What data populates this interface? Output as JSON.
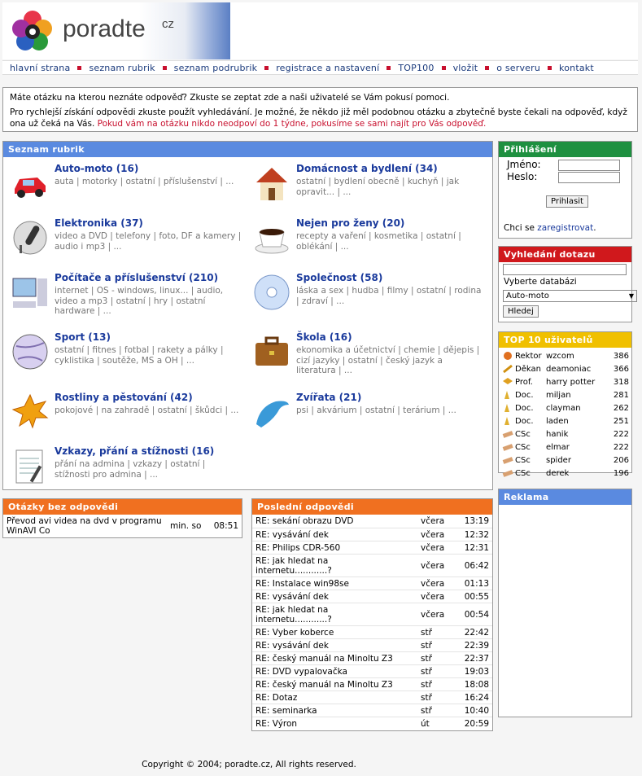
{
  "logo": {
    "text": "poradte",
    "suffix": "cz"
  },
  "nav": [
    "hlavní strana",
    "seznam rubrik",
    "seznam podrubrik",
    "registrace a nastavení",
    "TOP100",
    "vložit",
    "o serveru",
    "kontakt"
  ],
  "intro": {
    "line1": "Máte otázku na kterou neznáte odpověď? Zkuste se zeptat zde a naši uživatelé se Vám pokusí pomoci.",
    "line2": "Pro rychlejší získání odpovědi zkuste použít vyhledávání. Je možné, že někdo již měl podobnou otázku a zbytečně byste čekali na odpověď, když ona už čeká na Vás.",
    "line2_red": "Pokud vám na otázku nikdo neodpoví do 1 týdne, pokusíme se sami najít pro Vás odpověď."
  },
  "rubrics": {
    "title": "Seznam rubrik",
    "items": [
      {
        "title": "Auto-moto (16)",
        "subs": "auta | motorky | ostatní | příslušenství | ...",
        "icon": "car-icon"
      },
      {
        "title": "Domácnost a bydlení (34)",
        "subs": "ostatní | bydlení obecně | kuchyň | jak opravit... | ...",
        "icon": "house-icon"
      },
      {
        "title": "Elektronika (37)",
        "subs": "video a DVD | telefony | foto, DF a kamery | audio i mp3 | ...",
        "icon": "microphone-icon"
      },
      {
        "title": "Nejen pro ženy (20)",
        "subs": "recepty a vaření | kosmetika | ostatní | oblékání | ...",
        "icon": "coffee-cup-icon"
      },
      {
        "title": "Počítače a příslušenství (210)",
        "subs": "internet | OS - windows, linux... | audio, video a mp3 | ostatní | hry | ostatní hardware | ...",
        "icon": "computer-icon"
      },
      {
        "title": "Společnost (58)",
        "subs": "láska a sex | hudba | filmy | ostatní | rodina | zdraví | ...",
        "icon": "cd-icon"
      },
      {
        "title": "Sport (13)",
        "subs": "ostatní | fitnes | fotbal | rakety a pálky | cyklistika | soutěže, MS a OH | ...",
        "icon": "volleyball-icon"
      },
      {
        "title": "Škola (16)",
        "subs": "ekonomika a účetnictví | chemie | dějepis | cizí jazyky | ostatní | český jazyk a literatura | ...",
        "icon": "briefcase-icon"
      },
      {
        "title": "Rostliny a pěstování (42)",
        "subs": "pokojové | na zahradě | ostatní | škůdci | ...",
        "icon": "leaf-icon"
      },
      {
        "title": "Zvířata (21)",
        "subs": "psi | akvárium | ostatní | terárium | ...",
        "icon": "dolphin-icon"
      },
      {
        "title": "Vzkazy, přání a stížnosti (16)",
        "subs": "přání na admina | vzkazy | ostatní | stížnosti pro admina | ...",
        "icon": "notepad-icon"
      }
    ]
  },
  "unanswered": {
    "title": "Otázky bez odpovědi",
    "rows": [
      {
        "text": "Převod avi videa na dvd v programu WinAVI Co",
        "date": "min. so",
        "time": "08:51"
      }
    ]
  },
  "latest": {
    "title": "Poslední odpovědi",
    "rows": [
      {
        "text": "RE: sekání obrazu DVD",
        "date": "včera",
        "time": "13:19"
      },
      {
        "text": "RE: vysávání dek",
        "date": "včera",
        "time": "12:32"
      },
      {
        "text": "RE: Philips CDR-560",
        "date": "včera",
        "time": "12:31"
      },
      {
        "text": "RE: jak hledat na internetu............?",
        "date": "včera",
        "time": "06:42"
      },
      {
        "text": "RE: Instalace win98se",
        "date": "včera",
        "time": "01:13"
      },
      {
        "text": "RE: vysávání dek",
        "date": "včera",
        "time": "00:55"
      },
      {
        "text": "RE: jak hledat na internetu............?",
        "date": "včera",
        "time": "00:54"
      },
      {
        "text": "RE: Vyber koberce",
        "date": "stř",
        "time": "22:42"
      },
      {
        "text": "RE: vysávání dek",
        "date": "stř",
        "time": "22:39"
      },
      {
        "text": "RE: český manuál na Minoltu Z3",
        "date": "stř",
        "time": "22:37"
      },
      {
        "text": "RE: DVD vypalovačka",
        "date": "stř",
        "time": "19:03"
      },
      {
        "text": "RE: český manuál na Minoltu Z3",
        "date": "stř",
        "time": "18:08"
      },
      {
        "text": "RE: Dotaz",
        "date": "stř",
        "time": "16:24"
      },
      {
        "text": "RE: seminarka",
        "date": "stř",
        "time": "10:40"
      },
      {
        "text": "RE: Výron",
        "date": "út",
        "time": "20:59"
      }
    ]
  },
  "login": {
    "title": "Přihlášení",
    "name_label": "Jméno:",
    "pass_label": "Heslo:",
    "button": "Prihlasit",
    "register_prefix": "Chci se",
    "register_link": "zaregistrovat",
    "register_suffix": "."
  },
  "search": {
    "title": "Vyhledání dotazu",
    "db_label": "Vyberte databázi",
    "selected": "Auto-moto",
    "button": "Hledej"
  },
  "top10": {
    "title": "TOP 10 uživatelů",
    "rows": [
      {
        "rank": "Rektor",
        "name": "wzcom",
        "score": "386",
        "icon": "rektor-icon"
      },
      {
        "rank": "Děkan",
        "name": "deamoniac",
        "score": "366",
        "icon": "dekan-icon"
      },
      {
        "rank": "Prof.",
        "name": "harry potter",
        "score": "318",
        "icon": "prof-icon"
      },
      {
        "rank": "Doc.",
        "name": "miljan",
        "score": "281",
        "icon": "doc-icon"
      },
      {
        "rank": "Doc.",
        "name": "clayman",
        "score": "262",
        "icon": "doc-icon"
      },
      {
        "rank": "Doc.",
        "name": "laden",
        "score": "251",
        "icon": "doc-icon"
      },
      {
        "rank": "CSc",
        "name": "hanik",
        "score": "222",
        "icon": "csc-icon"
      },
      {
        "rank": "CSc",
        "name": "elmar",
        "score": "222",
        "icon": "csc-icon"
      },
      {
        "rank": "CSc",
        "name": "spider",
        "score": "206",
        "icon": "csc-icon"
      },
      {
        "rank": "CSc",
        "name": "derek",
        "score": "196",
        "icon": "csc-icon"
      }
    ]
  },
  "ads": {
    "title": "Reklama"
  },
  "footer": "Copyright © 2004; poradte.cz, All rights reserved."
}
